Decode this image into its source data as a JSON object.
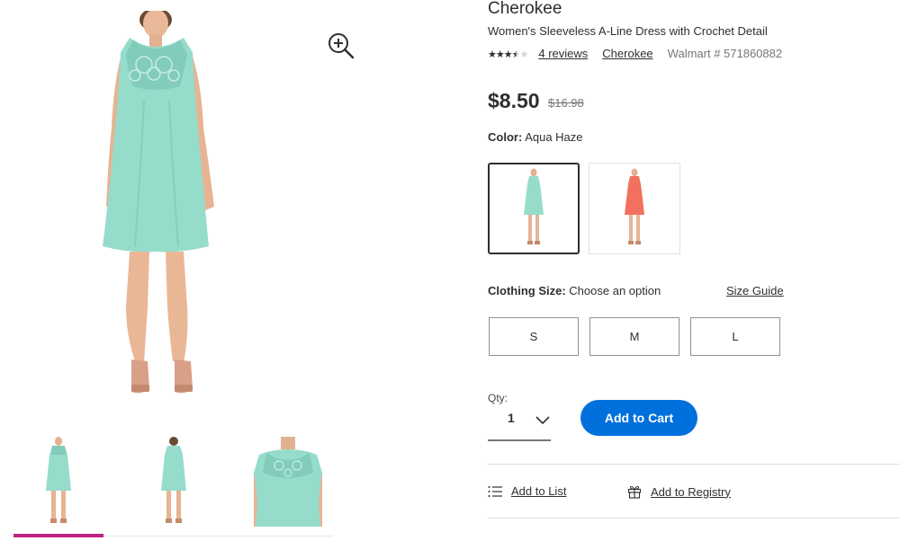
{
  "product": {
    "brand": "Cherokee",
    "name": "Women's Sleeveless A-Line Dress with Crochet Detail",
    "rating_stars": 3.5,
    "reviews_link": "4 reviews",
    "brand_link": "Cherokee",
    "walmart_number": "Walmart # 571860882",
    "price": "$8.50",
    "was_price": "$16.98"
  },
  "color": {
    "label": "Color:",
    "value": "Aqua Haze",
    "swatches": [
      {
        "name": "aqua",
        "color": "#96dccb",
        "selected": true
      },
      {
        "name": "coral",
        "color": "#f2705e",
        "selected": false
      }
    ]
  },
  "size": {
    "label": "Clothing Size:",
    "value": "Choose an option",
    "guide": "Size Guide",
    "options": [
      "S",
      "M",
      "L"
    ]
  },
  "qty": {
    "label": "Qty:",
    "value": "1"
  },
  "actions": {
    "add_to_cart": "Add to Cart",
    "add_to_list": "Add to List",
    "add_to_registry": "Add to Registry"
  },
  "icons": {
    "zoom": "zoom-in-icon",
    "list": "list-icon",
    "gift": "gift-icon",
    "chevron": "chevron-down-icon"
  },
  "colors": {
    "accent_blue": "#0071dc",
    "thumb_indicator": "#c22283",
    "dress_aqua": "#96dccb",
    "dress_coral": "#f2705e"
  }
}
